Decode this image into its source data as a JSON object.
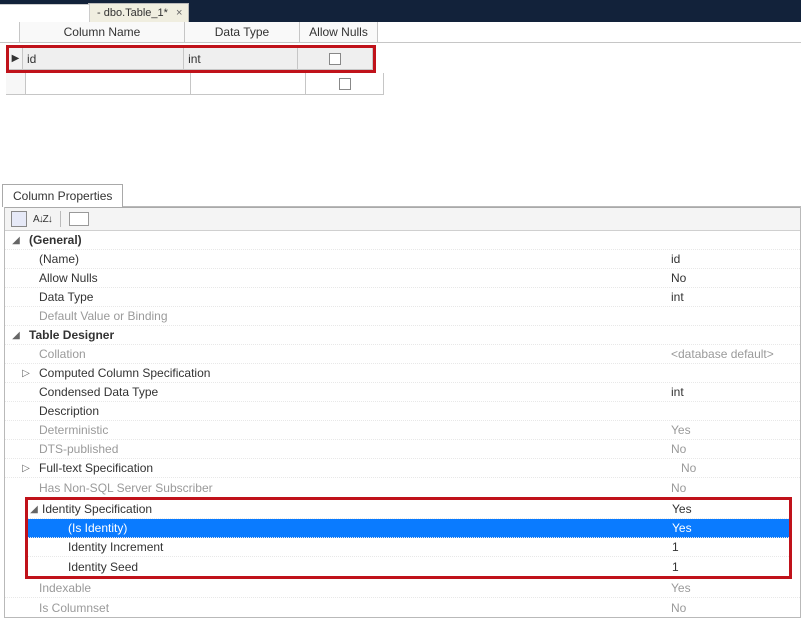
{
  "tab": {
    "title": "- dbo.Table_1*",
    "close": "×",
    "prefix": ""
  },
  "grid": {
    "headers": {
      "colname": "Column Name",
      "datatype": "Data Type",
      "allow": "Allow Nulls"
    },
    "row1": {
      "colname": "id",
      "datatype": "int",
      "allow_checked": false
    }
  },
  "panel": {
    "title": "Column Properties",
    "azsort": "A↓Z↓"
  },
  "props": {
    "general": {
      "header": "(General)",
      "name": {
        "label": "(Name)",
        "value": "id"
      },
      "allownulls": {
        "label": "Allow Nulls",
        "value": "No"
      },
      "datatype": {
        "label": "Data Type",
        "value": "int"
      },
      "defaultval": {
        "label": "Default Value or Binding",
        "value": ""
      }
    },
    "tabledesigner": {
      "header": "Table Designer",
      "collation": {
        "label": "Collation",
        "value": "<database default>"
      },
      "computed": {
        "label": "Computed Column Specification",
        "value": ""
      },
      "condensed": {
        "label": "Condensed Data Type",
        "value": "int"
      },
      "description": {
        "label": "Description",
        "value": ""
      },
      "deterministic": {
        "label": "Deterministic",
        "value": "Yes"
      },
      "dtspub": {
        "label": "DTS-published",
        "value": "No"
      },
      "fulltext": {
        "label": "Full-text Specification",
        "value": "No"
      },
      "nonsql": {
        "label": "Has Non-SQL Server Subscriber",
        "value": "No"
      },
      "identityspec": {
        "label": "Identity Specification",
        "value": "Yes"
      },
      "isidentity": {
        "label": "(Is Identity)",
        "value": "Yes"
      },
      "increment": {
        "label": "Identity Increment",
        "value": "1"
      },
      "seed": {
        "label": "Identity Seed",
        "value": "1"
      },
      "indexable": {
        "label": "Indexable",
        "value": "Yes"
      },
      "iscolumnset": {
        "label": "Is Columnset",
        "value": "No"
      }
    }
  }
}
